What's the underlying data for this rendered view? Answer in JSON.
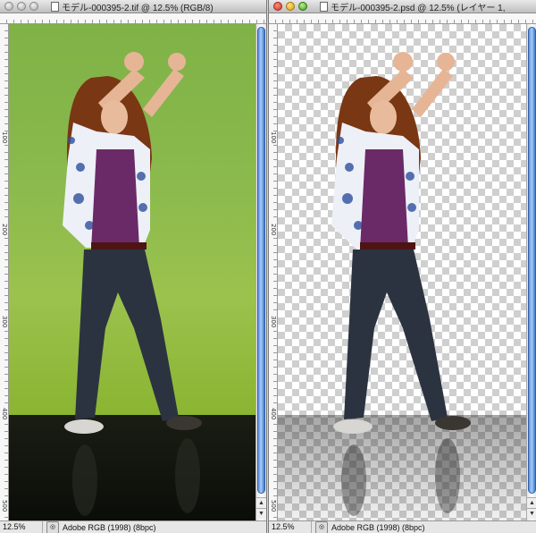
{
  "left_window": {
    "title": "モデル-000395-2.tif @ 12.5% (RGB/8)",
    "zoom": "12.5%",
    "profile": "Adobe RGB (1998) (8bpc)",
    "ruler_left_ticks": [
      "100",
      "200",
      "300",
      "400",
      "500"
    ]
  },
  "right_window": {
    "title": "モデル-000395-2.psd @ 12.5% (レイヤー 1,",
    "zoom": "12.5%",
    "profile": "Adobe RGB (1998) (8bpc)",
    "ruler_left_ticks": [
      "100",
      "200",
      "300",
      "400",
      "500"
    ]
  },
  "colors": {
    "green_screen": "#8ab94d",
    "scrollbar_thumb": "#5a8fd8"
  },
  "icons": {
    "close": "close-icon",
    "minimize": "minimize-icon",
    "zoom": "zoom-icon",
    "status_arrow": "status-arrow-icon"
  }
}
